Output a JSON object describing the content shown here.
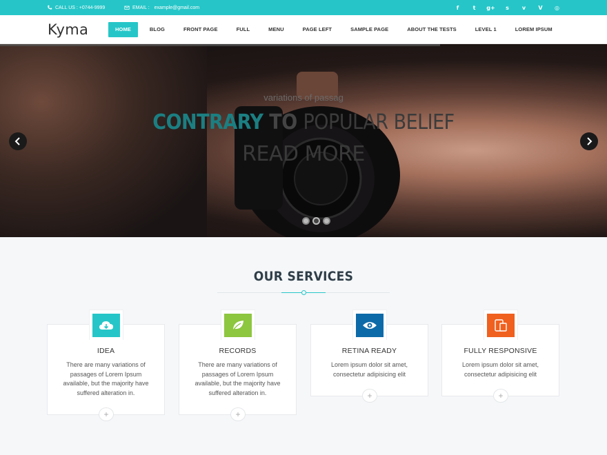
{
  "topbar": {
    "phone_label": "CALL US : +0744-9999",
    "email_label": "EMAIL :",
    "email_value": "example@gmail.com",
    "social_icons": [
      "facebook-icon",
      "twitter-icon",
      "google-plus-icon",
      "skype-icon",
      "vimeo-icon",
      "vine-icon",
      "dribbble-icon"
    ]
  },
  "header": {
    "logo": "Kyma",
    "nav": [
      {
        "label": "HOME",
        "active": true
      },
      {
        "label": "BLOG"
      },
      {
        "label": "FRONT PAGE"
      },
      {
        "label": "FULL"
      },
      {
        "label": "MENU"
      },
      {
        "label": "PAGE LEFT"
      },
      {
        "label": "SAMPLE PAGE"
      },
      {
        "label": "ABOUT THE TESTS"
      },
      {
        "label": "LEVEL 1"
      },
      {
        "label": "LOREM IPSUM"
      }
    ]
  },
  "hero": {
    "subtitle": "variations of passag",
    "headline_w1": "CONTRARY",
    "headline_w2": "TO",
    "headline_w3": "POPULAR BELIEF",
    "read_more": "READ MORE",
    "slide_count": 3,
    "active_slide": 2
  },
  "services": {
    "title": "OUR SERVICES",
    "cards": [
      {
        "name": "IDEA",
        "icon": "cloud-download-icon",
        "color": "#26c6c8",
        "desc": "There are many variations of passages of Lorem Ipsum available, but the majority have suffered alteration in."
      },
      {
        "name": "RECORDS",
        "icon": "leaf-icon",
        "color": "#8dc63f",
        "desc": "There are many variations of passages of Lorem Ipsum available, but the majority have suffered alteration in."
      },
      {
        "name": "RETINA READY",
        "icon": "eye-icon",
        "color": "#0d6aa8",
        "desc": "Lorem ipsum dolor sit amet, consectetur adipisicing elit"
      },
      {
        "name": "FULLY RESPONSIVE",
        "icon": "devices-icon",
        "color": "#f0601e",
        "desc": "Lorem ipsum dolor sit amet, consectetur adipisicing elit"
      }
    ],
    "plus_label": "+"
  }
}
